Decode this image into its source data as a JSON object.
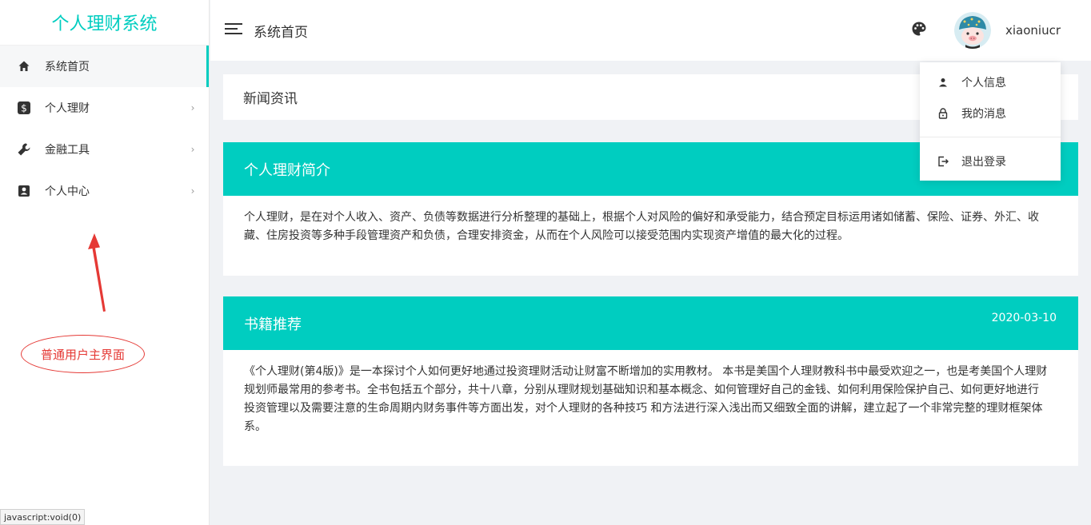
{
  "sidebar": {
    "brand": "个人理财系统",
    "items": [
      {
        "label": "系统首页",
        "icon": "home-icon",
        "active": true
      },
      {
        "label": "个人理财",
        "icon": "dollar-icon",
        "arrow": "›"
      },
      {
        "label": "金融工具",
        "icon": "wrench-icon",
        "arrow": "›"
      },
      {
        "label": "个人中心",
        "icon": "contact-card-icon",
        "arrow": "›"
      }
    ]
  },
  "annotation": {
    "text": "普通用户主界面",
    "color": "#e53935"
  },
  "statusbar": {
    "text": "javascript:void(0)"
  },
  "header": {
    "title": "系统首页",
    "username": "xiaoniucr"
  },
  "user_menu": {
    "items": [
      {
        "label": "个人信息",
        "icon": "user-icon"
      },
      {
        "label": "我的消息",
        "icon": "lock-icon"
      },
      {
        "label": "退出登录",
        "icon": "logout-icon"
      }
    ]
  },
  "news": {
    "title": "新闻资讯"
  },
  "cards": [
    {
      "title": "个人理财简介",
      "date": "",
      "body": "个人理财，是在对个人收入、资产、负债等数据进行分析整理的基础上，根据个人对风险的偏好和承受能力，结合预定目标运用诸如储蓄、保险、证券、外汇、收藏、住房投资等多种手段管理资产和负债，合理安排资金，从而在个人风险可以接受范围内实现资产增值的最大化的过程。"
    },
    {
      "title": "书籍推荐",
      "date": "2020-03-10",
      "body": "《个人理财(第4版)》是一本探讨个人如何更好地通过投资理财活动让财富不断增加的实用教材。 本书是美国个人理财教科书中最受欢迎之一，也是考美国个人理财规划师最常用的参考书。全书包括五个部分，共十八章，分别从理财规划基础知识和基本概念、如何管理好自己的金钱、如何利用保险保护自己、如何更好地进行投资管理以及需要注意的生命周期内财务事件等方面出发，对个人理财的各种技巧 和方法进行深入浅出而又细致全面的讲解，建立起了一个非常完整的理财框架体系。"
    }
  ],
  "colors": {
    "accent": "#00cdc0",
    "annotation": "#e53935"
  }
}
